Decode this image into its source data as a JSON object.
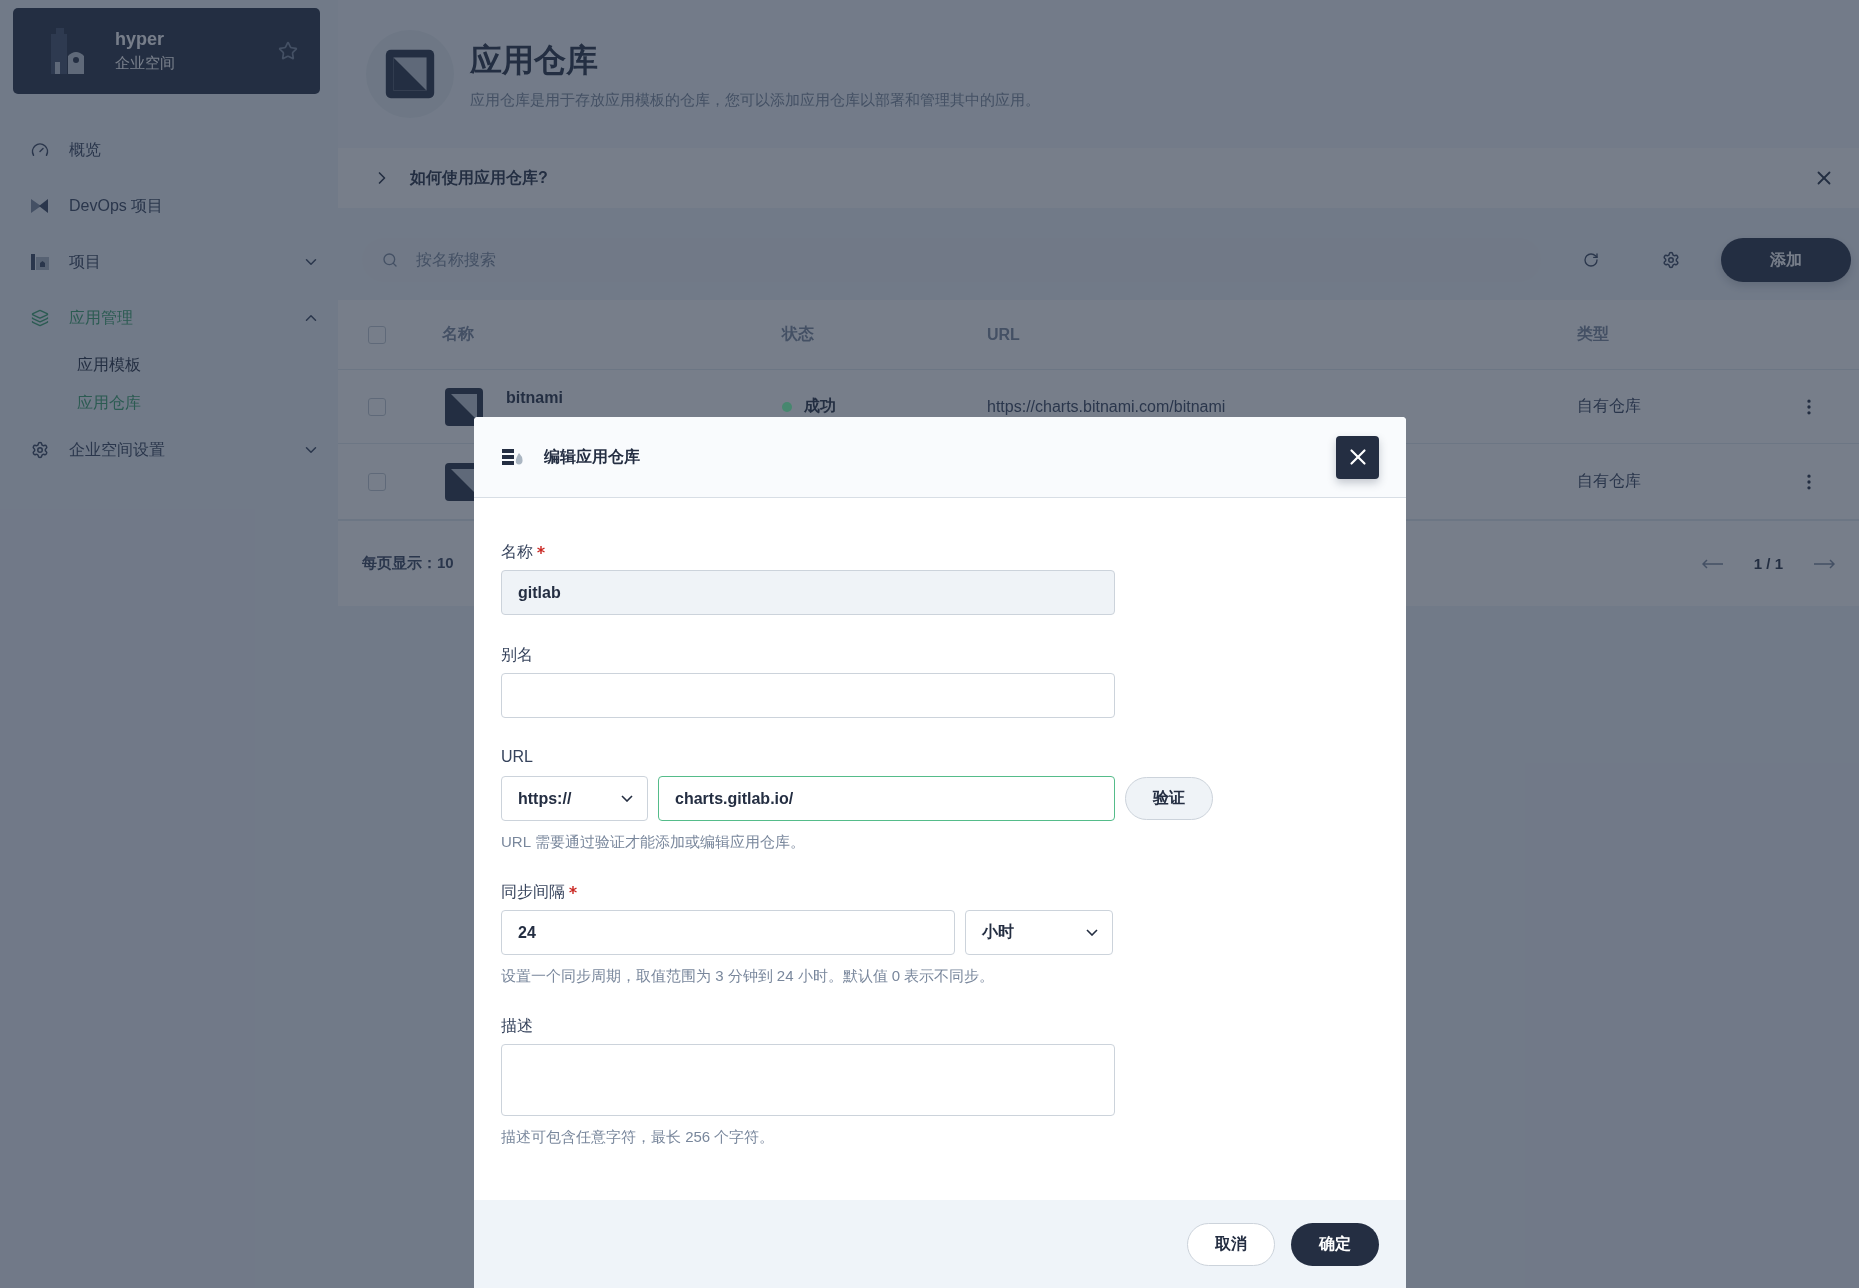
{
  "workspace": {
    "name": "hyper",
    "subtitle": "企业空间"
  },
  "nav": [
    {
      "kind": "overview",
      "label": "概览",
      "selected": false
    },
    {
      "kind": "devops",
      "label": "DevOps 项目",
      "selected": false
    },
    {
      "kind": "projects",
      "label": "项目",
      "expanded": false,
      "selected": false
    },
    {
      "kind": "apps",
      "label": "应用管理",
      "expanded": true,
      "selected": true,
      "children": [
        {
          "label": "应用模板",
          "selected": false
        },
        {
          "label": "应用仓库",
          "selected": true
        }
      ]
    },
    {
      "kind": "settings",
      "label": "企业空间设置",
      "expanded": false,
      "selected": false
    }
  ],
  "header": {
    "title": "应用仓库",
    "description": "应用仓库是用于存放应用模板的仓库，您可以添加应用仓库以部署和管理其中的应用。"
  },
  "guide": {
    "label": "如何使用应用仓库?"
  },
  "toolbar": {
    "search_placeholder": "按名称搜索",
    "add_button": "添加"
  },
  "table": {
    "all_checked": false,
    "columns": [
      "名称",
      "状态",
      "URL",
      "类型"
    ],
    "rows": [
      {
        "checked": false,
        "name": "bitnami",
        "status": "成功",
        "color": "#47876f",
        "url": "https://charts.bitnami.com/bitnami",
        "type": "自有仓库"
      },
      {
        "checked": false,
        "type": "自有仓库"
      }
    ]
  },
  "pagination": {
    "page_size": "每页显示：10",
    "page": "1 / 1"
  },
  "dialog": {
    "title": "编辑应用仓库",
    "fields": [
      {
        "kind": "text",
        "label": "名称",
        "required": true,
        "disabled": true,
        "value": "gitlab"
      },
      {
        "kind": "text",
        "label": "别名",
        "required": false,
        "disabled": false
      },
      {
        "kind": "url",
        "label": "URL",
        "required": false,
        "protocol": "https://",
        "value": "charts.gitlab.io/",
        "verify_button": "验证",
        "hint": "URL 需要通过验证才能添加或编辑应用仓库。"
      },
      {
        "kind": "interval",
        "label": "同步间隔",
        "required": true,
        "value": "24",
        "unit": "小时",
        "hint": "设置一个同步周期，取值范围为 3 分钟到 24 小时。默认值 0 表示不同步。"
      },
      {
        "kind": "textarea",
        "label": "描述",
        "required": false,
        "hint": "描述可包含任意字符，最长 256 个字符。"
      }
    ],
    "cancel_button": "取消",
    "confirm_button": "确定"
  }
}
